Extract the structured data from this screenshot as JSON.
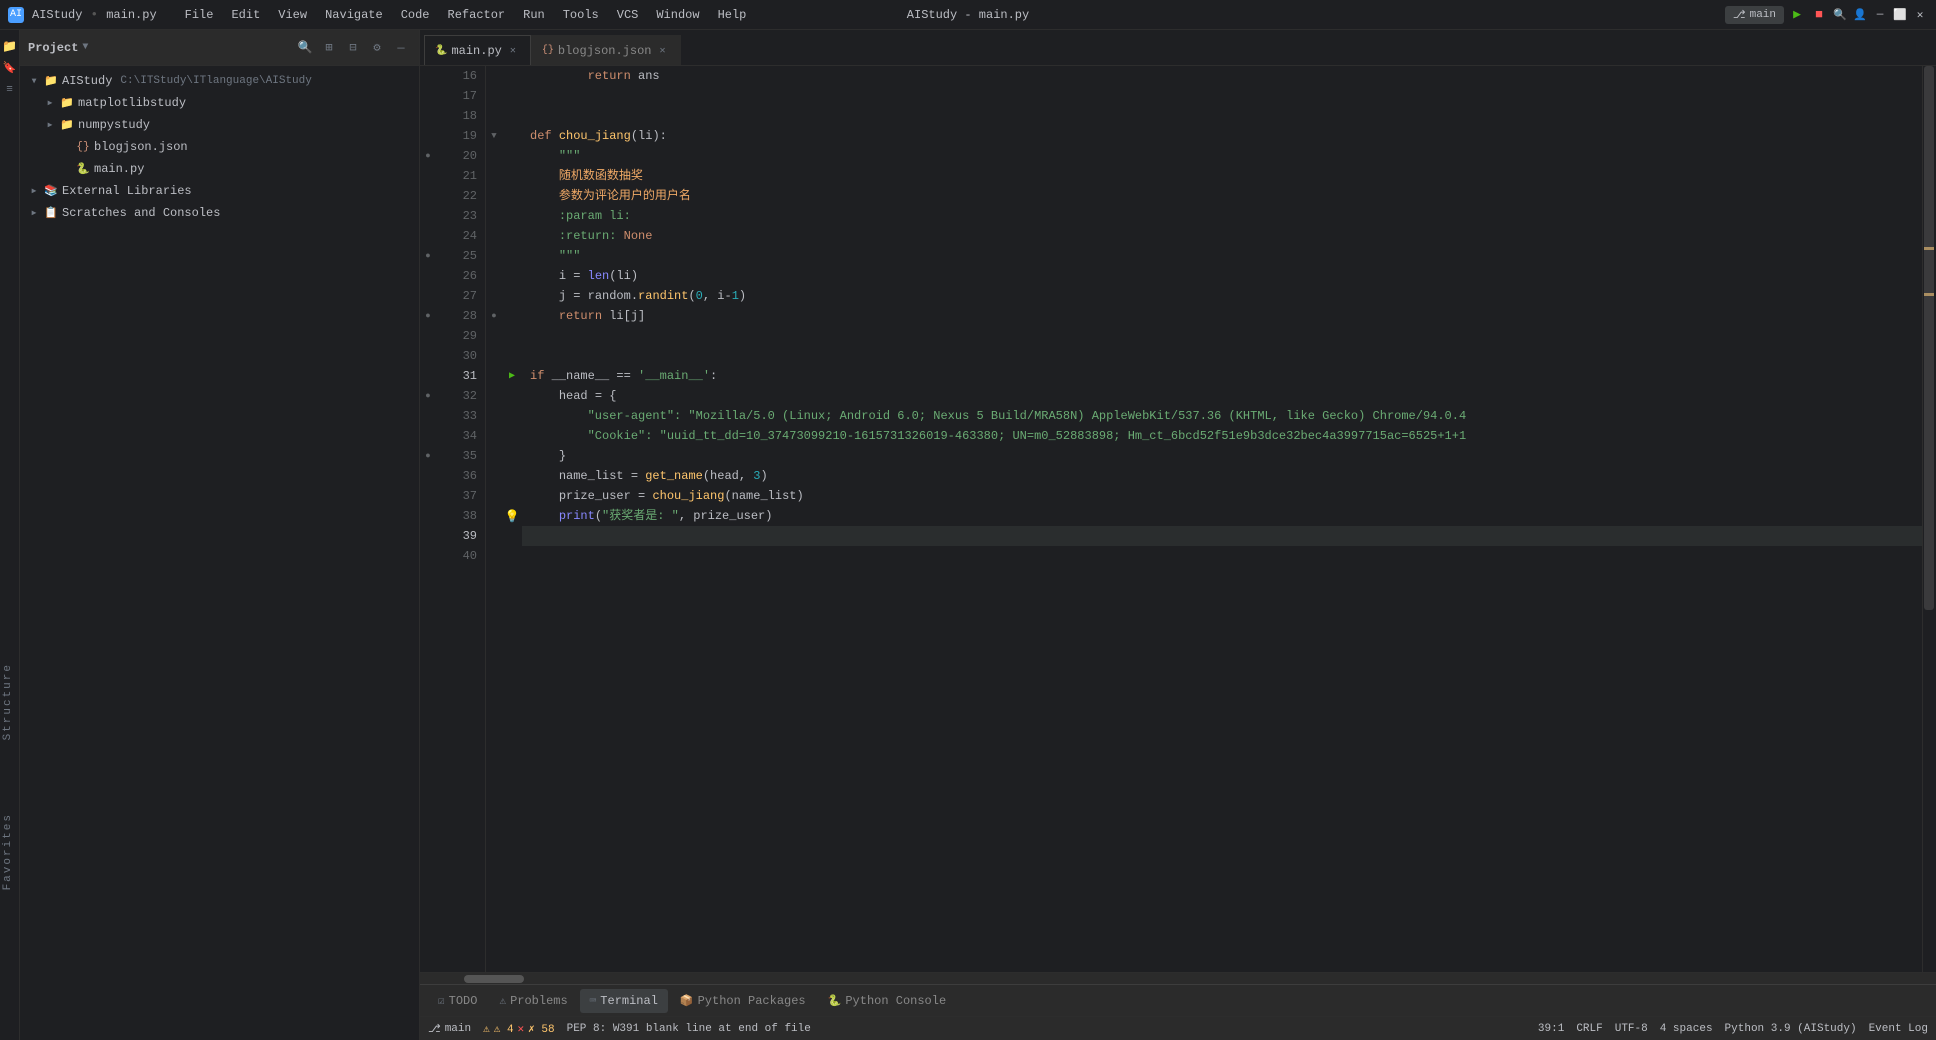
{
  "app": {
    "name": "AIStudy",
    "title": "AIStudy - main.py",
    "active_file": "main.py"
  },
  "menu": {
    "items": [
      "File",
      "Edit",
      "View",
      "Navigate",
      "Code",
      "Refactor",
      "Run",
      "Tools",
      "VCS",
      "Window",
      "Help"
    ]
  },
  "toolbar": {
    "branch": "main",
    "run_label": "▶",
    "stop_label": "■"
  },
  "tabs": [
    {
      "label": "main.py",
      "active": true,
      "icon": "py"
    },
    {
      "label": "blogjson.json",
      "active": false,
      "icon": "json"
    }
  ],
  "project": {
    "title": "Project",
    "root": {
      "name": "AIStudy",
      "path": "C:\\ITStudy\\ITlanguage\\AIStudy",
      "expanded": true,
      "children": [
        {
          "name": "matplotlibstudy",
          "type": "folder",
          "expanded": false
        },
        {
          "name": "numpystudy",
          "type": "folder",
          "expanded": false
        },
        {
          "name": "blogjson.json",
          "type": "json"
        },
        {
          "name": "main.py",
          "type": "py"
        }
      ]
    },
    "external_libraries": "External Libraries",
    "scratches": "Scratches and Consoles"
  },
  "code": {
    "lines": [
      {
        "num": 16,
        "content": "        return ans",
        "tokens": [
          {
            "t": "kw",
            "v": "        return "
          },
          {
            "t": "var",
            "v": "ans"
          }
        ]
      },
      {
        "num": 17,
        "content": ""
      },
      {
        "num": 18,
        "content": ""
      },
      {
        "num": 19,
        "content": "def chou_jiang(li):",
        "tokens": [
          {
            "t": "kw",
            "v": "def "
          },
          {
            "t": "fn2",
            "v": "chou_jiang"
          },
          {
            "t": "punc",
            "v": "("
          },
          {
            "t": "param",
            "v": "li"
          },
          {
            "t": "punc",
            "v": "):"
          }
        ]
      },
      {
        "num": 20,
        "content": "    \"\"\"",
        "tokens": [
          {
            "t": "str",
            "v": "    \"\"\""
          }
        ]
      },
      {
        "num": 21,
        "content": "    随机数函数抽奖",
        "tokens": [
          {
            "t": "chinese",
            "v": "    随机数函数抽奖"
          }
        ]
      },
      {
        "num": 22,
        "content": "    参数为评论用户的用户名",
        "tokens": [
          {
            "t": "chinese",
            "v": "    参数为评论用户的用户名"
          }
        ]
      },
      {
        "num": 23,
        "content": "    :param li:",
        "tokens": [
          {
            "t": "str",
            "v": "    :param li:"
          }
        ]
      },
      {
        "num": 24,
        "content": "    :return: None",
        "tokens": [
          {
            "t": "str",
            "v": "    :return: "
          },
          {
            "t": "str",
            "v": "None"
          }
        ]
      },
      {
        "num": 25,
        "content": "    \"\"\"",
        "tokens": [
          {
            "t": "str",
            "v": "    \"\"\""
          }
        ]
      },
      {
        "num": 26,
        "content": "    i = len(li)",
        "tokens": [
          {
            "t": "var",
            "v": "    i "
          },
          {
            "t": "punc",
            "v": "= "
          },
          {
            "t": "builtin",
            "v": "len"
          },
          {
            "t": "punc",
            "v": "("
          },
          {
            "t": "var",
            "v": "li"
          },
          {
            "t": "punc",
            "v": ")"
          }
        ]
      },
      {
        "num": 27,
        "content": "    j = random.randint(0, i-1)",
        "tokens": [
          {
            "t": "var",
            "v": "    j "
          },
          {
            "t": "punc",
            "v": "= "
          },
          {
            "t": "var",
            "v": "random"
          },
          {
            "t": "punc",
            "v": "."
          },
          {
            "t": "fn2",
            "v": "randint"
          },
          {
            "t": "punc",
            "v": "("
          },
          {
            "t": "num",
            "v": "0"
          },
          {
            "t": "punc",
            "v": ", "
          },
          {
            "t": "var",
            "v": "i"
          },
          {
            "t": "punc",
            "v": "-"
          },
          {
            "t": "num",
            "v": "1"
          },
          {
            "t": "punc",
            "v": ")"
          }
        ]
      },
      {
        "num": 28,
        "content": "    return li[j]",
        "tokens": [
          {
            "t": "kw",
            "v": "    return "
          },
          {
            "t": "var",
            "v": "li"
          },
          {
            "t": "punc",
            "v": "["
          },
          {
            "t": "var",
            "v": "j"
          },
          {
            "t": "punc",
            "v": "]"
          }
        ]
      },
      {
        "num": 29,
        "content": ""
      },
      {
        "num": 30,
        "content": ""
      },
      {
        "num": 31,
        "content": "if __name__ == '__main__':",
        "tokens": [
          {
            "t": "kw",
            "v": "if "
          },
          {
            "t": "var",
            "v": "__name__"
          },
          {
            "t": "punc",
            "v": " == "
          },
          {
            "t": "str",
            "v": "'__main__'"
          },
          {
            "t": "punc",
            "v": ":"
          }
        ],
        "runnable": true
      },
      {
        "num": 32,
        "content": "    head = {",
        "tokens": [
          {
            "t": "var",
            "v": "    head "
          },
          {
            "t": "punc",
            "v": "= {"
          }
        ]
      },
      {
        "num": 33,
        "content": "        \"user-agent\": \"Mozilla/5.0 (Linux; Android 6.0; Nexus 5 Build/MRA58N) AppleWebKit/537.36 (KHTML, like Gecko) Chrome/94.0.4",
        "tokens": [
          {
            "t": "str",
            "v": "        \"user-agent\": \"Mozilla/5.0 (Linux; Android 6.0; Nexus 5 Build/MRA58N) AppleWebKit/537.36 (KHTML, like Gecko) Chrome/94.0.4"
          }
        ]
      },
      {
        "num": 34,
        "content": "        \"Cookie\": \"uuid_tt_dd=10_37473099210-1615731326019-463380; UN=m0_52883898; Hm_ct_6bcd52f51e9b3dce32bec4a3997715ac=6525+1+1",
        "tokens": [
          {
            "t": "str",
            "v": "        \"Cookie\": \"uuid_tt_dd=10_37473099210-1615731326019-463380; UN=m0_52883898; Hm_ct_6bcd52f51e9b3dce32bec4a3997715ac=6525+1+1"
          }
        ]
      },
      {
        "num": 35,
        "content": "    }",
        "tokens": [
          {
            "t": "punc",
            "v": "    }"
          }
        ]
      },
      {
        "num": 36,
        "content": "    name_list = get_name(head, 3)",
        "tokens": [
          {
            "t": "var",
            "v": "    name_list "
          },
          {
            "t": "punc",
            "v": "= "
          },
          {
            "t": "fn2",
            "v": "get_name"
          },
          {
            "t": "punc",
            "v": "("
          },
          {
            "t": "var",
            "v": "head"
          },
          {
            "t": "punc",
            "v": ", "
          },
          {
            "t": "num",
            "v": "3"
          },
          {
            "t": "punc",
            "v": ")"
          }
        ]
      },
      {
        "num": 37,
        "content": "    prize_user = chou_jiang(name_list)",
        "tokens": [
          {
            "t": "var",
            "v": "    prize_user "
          },
          {
            "t": "punc",
            "v": "= "
          },
          {
            "t": "fn2",
            "v": "chou_jiang"
          },
          {
            "t": "punc",
            "v": "("
          },
          {
            "t": "var",
            "v": "name_list"
          },
          {
            "t": "punc",
            "v": ")"
          }
        ]
      },
      {
        "num": 38,
        "content": "    print(\"获奖者是: \", prize_user)",
        "tokens": [
          {
            "t": "builtin",
            "v": "    print"
          },
          {
            "t": "punc",
            "v": "("
          },
          {
            "t": "str",
            "v": "\"获奖者是: \""
          },
          {
            "t": "punc",
            "v": ", "
          },
          {
            "t": "var",
            "v": "prize_user"
          },
          {
            "t": "punc",
            "v": ")"
          }
        ],
        "warn": true
      },
      {
        "num": 39,
        "content": ""
      },
      {
        "num": 40,
        "content": ""
      }
    ]
  },
  "status_bar": {
    "pep8_warning": "PEP 8: W391 blank line at end of file",
    "line_col": "39:1",
    "encoding": "CRLF",
    "charset": "UTF-8",
    "indent": "4 spaces",
    "python": "Python 3.9 (AIStudy)",
    "event_log": "Event Log",
    "warnings": "⚠ 4",
    "errors": "✗ 58"
  },
  "bottom_tabs": [
    {
      "label": "TODO",
      "icon": "todo",
      "active": false
    },
    {
      "label": "Problems",
      "icon": "problems",
      "active": false
    },
    {
      "label": "Terminal",
      "icon": "terminal",
      "active": false
    },
    {
      "label": "Python Packages",
      "icon": "packages",
      "active": false
    },
    {
      "label": "Python Console",
      "icon": "console",
      "active": false
    }
  ]
}
